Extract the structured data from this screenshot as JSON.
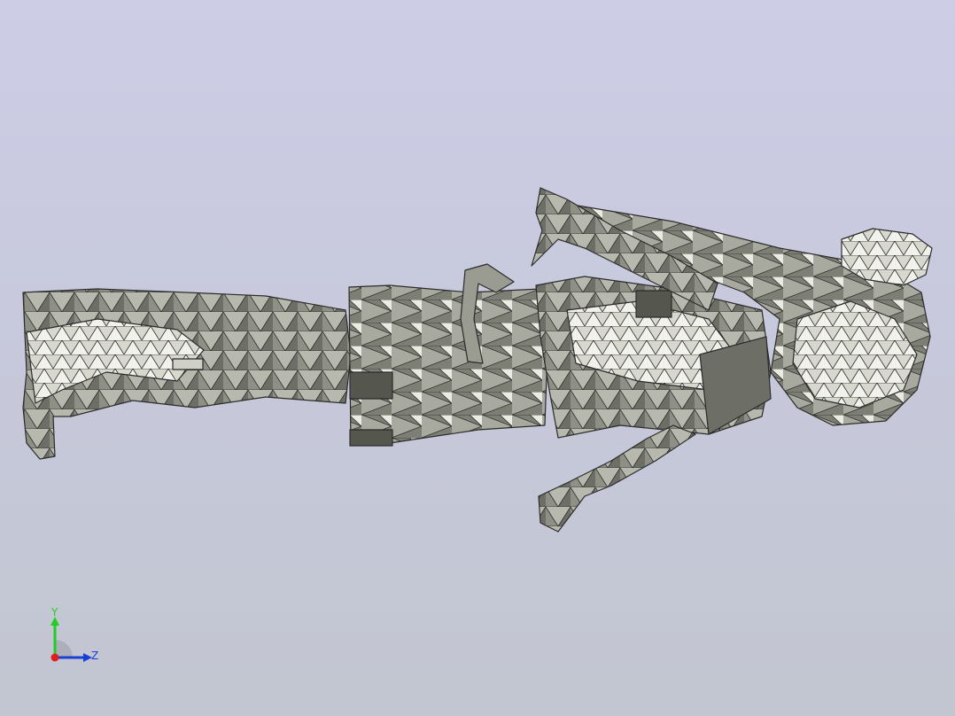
{
  "viewport": {
    "colors": {
      "background_top": "#cdcde6",
      "background_bottom": "#c2c6d0",
      "mesh_fill": "#8e8f85",
      "mesh_light": "#e8e8e0",
      "mesh_dark": "#55574f",
      "mesh_edge": "#2b2b2b"
    }
  },
  "triad": {
    "y_label": "Y",
    "z_label": "Z",
    "colors": {
      "y": "#22cc22",
      "z": "#1a3fd6",
      "x": "#e02020"
    }
  }
}
